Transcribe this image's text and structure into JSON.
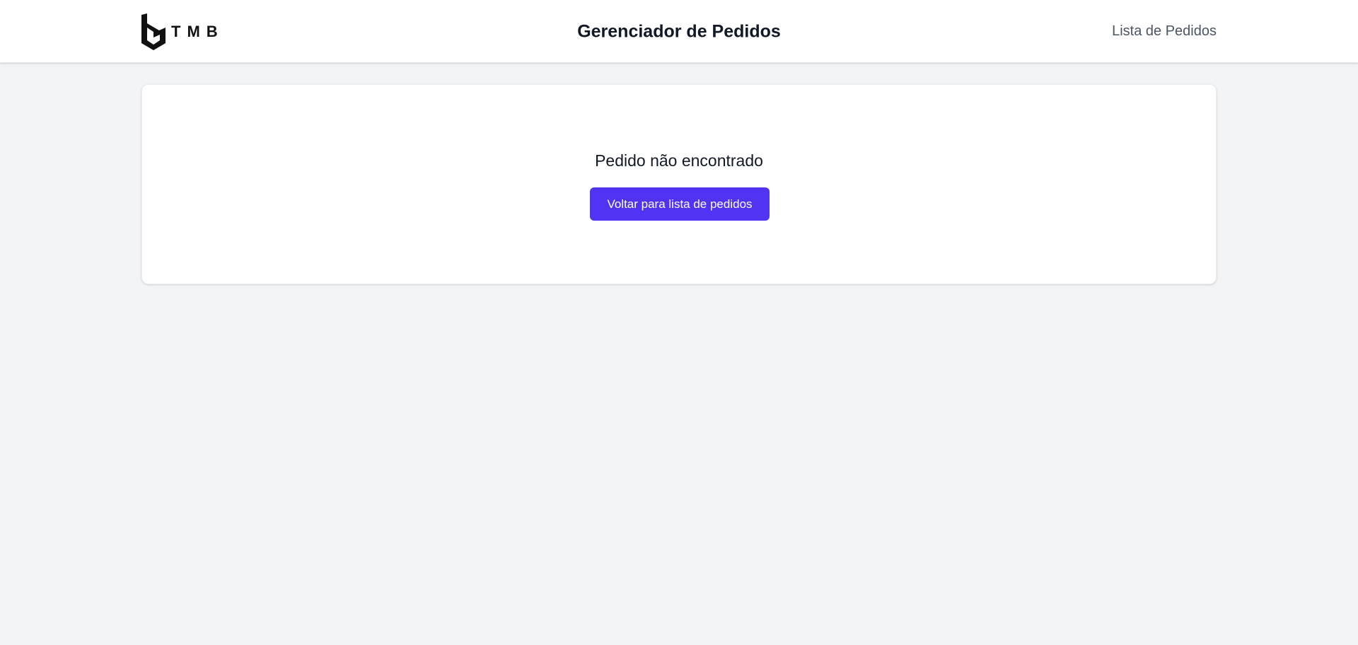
{
  "header": {
    "brand_text": "TMB",
    "title": "Gerenciador de Pedidos",
    "nav_link": "Lista de Pedidos",
    "logo_icon": "tmb-logo-icon"
  },
  "main": {
    "message": "Pedido não encontrado",
    "back_button_label": "Voltar para lista de pedidos"
  },
  "colors": {
    "background": "#f3f4f6",
    "card": "#ffffff",
    "accent": "#4f35f3",
    "title_text": "#111827",
    "nav_text": "#4b5563"
  }
}
